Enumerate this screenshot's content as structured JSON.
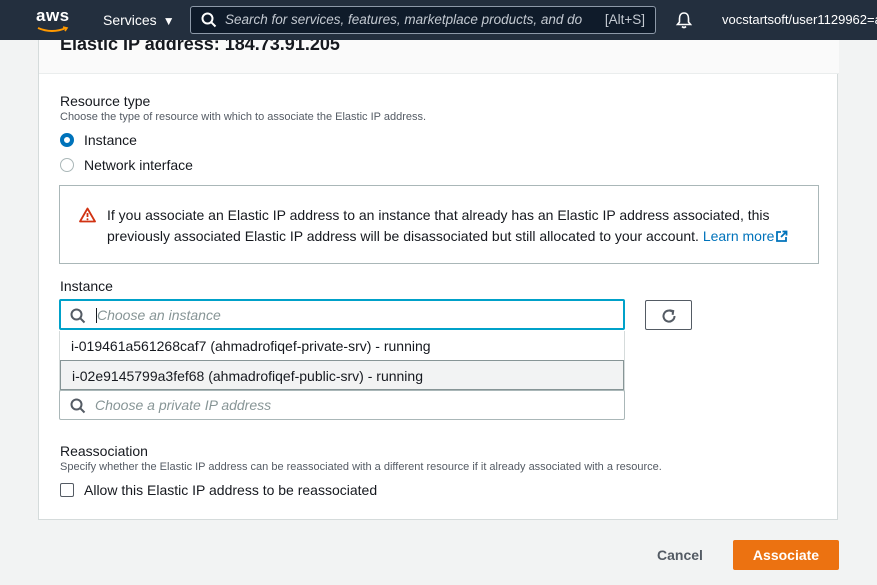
{
  "nav": {
    "logo_text": "aws",
    "services_label": "Services",
    "search_placeholder": "Search for services, features, marketplace products, and do",
    "search_shortcut": "[Alt+S]",
    "account": "vocstartsoft/user1129962=a"
  },
  "card": {
    "title": "Elastic IP address: 184.73.91.205"
  },
  "resource_type": {
    "label": "Resource type",
    "description": "Choose the type of resource with which to associate the Elastic IP address.",
    "options": [
      {
        "label": "Instance",
        "selected": true
      },
      {
        "label": "Network interface",
        "selected": false
      }
    ]
  },
  "alert": {
    "message": "If you associate an Elastic IP address to an instance that already has an Elastic IP address associated, this previously associated Elastic IP address will be disassociated but still allocated to your account.",
    "link_text": "Learn more",
    "icon": "warning-icon"
  },
  "instance": {
    "label": "Instance",
    "placeholder": "Choose an instance",
    "options": [
      "i-019461a561268caf7 (ahmadrofiqef-private-srv) - running",
      "i-02e9145799a3fef68 (ahmadrofiqef-public-srv) - running"
    ]
  },
  "private_ip": {
    "placeholder": "Choose a private IP address"
  },
  "reassociation": {
    "label": "Reassociation",
    "description": "Specify whether the Elastic IP address can be reassociated with a different resource if it already associated with a resource.",
    "checkbox_label": "Allow this Elastic IP address to be reassociated",
    "checked": false
  },
  "footer": {
    "cancel_label": "Cancel",
    "associate_label": "Associate"
  },
  "colors": {
    "nav_bg": "#232f3e",
    "accent_blue": "#0073bb",
    "focus_ring": "#00a1c9",
    "primary_button": "#ec7211",
    "warning": "#d13212"
  }
}
